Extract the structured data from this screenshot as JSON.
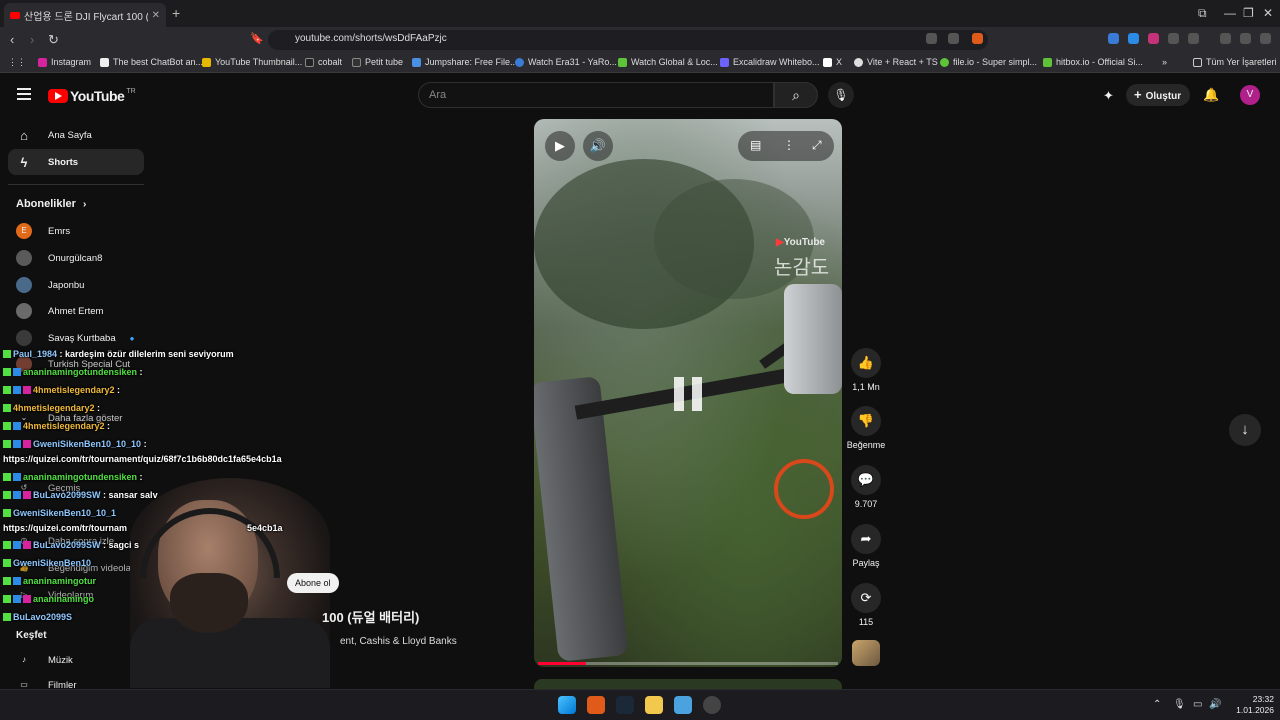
{
  "browser": {
    "tab_title": "산업용 드론 DJI Flycart 100 (듀얼 배터리)",
    "url": "youtube.com/shorts/wsDdFAaPzjc",
    "bookmarks": [
      "Instagram",
      "The best ChatBot an...",
      "YouTube Thumbnail...",
      "cobalt",
      "Petit tube",
      "Jumpshare: Free File...",
      "Watch Era31 - YaRo...",
      "Watch Global & Loc...",
      "Excalidraw Whitebo...",
      "X",
      "Vite + React + TS",
      "file.io - Super simpl...",
      "hitbox.io - Official Si..."
    ],
    "all_bookmarks_label": "Tüm Yer İşaretleri"
  },
  "header": {
    "logo_text": "YouTube",
    "logo_region": "TR",
    "search_placeholder": "Ara",
    "create_label": "Oluştur",
    "avatar_letter": "V"
  },
  "sidebar": {
    "home": "Ana Sayfa",
    "shorts": "Shorts",
    "subscriptions_heading": "Abonelikler",
    "subscriptions": [
      {
        "name": "Emrs",
        "initial": "E",
        "color": "#e06a1a"
      },
      {
        "name": "Onurgülcan8",
        "initial": "",
        "color": "#5a5a5a"
      },
      {
        "name": "Japonbu",
        "initial": "",
        "color": "#4a6a8a"
      },
      {
        "name": "Ahmet Ertem",
        "initial": "",
        "color": "#6a6a6a"
      },
      {
        "name": "Savaş Kurtbaba",
        "initial": "",
        "color": "#3a3a3a"
      },
      {
        "name": "Turkish Special Cut",
        "initial": "",
        "color": "#8a4a3a"
      }
    ],
    "show_more": "Daha fazla göster",
    "history": "Geçmiş",
    "watch_later": "Daha sonra izle",
    "liked": "Beğendiğim videolar",
    "your_videos": "Videolarım",
    "explore_heading": "Keşfet",
    "music": "Müzik",
    "films": "Filmler"
  },
  "chat": [
    {
      "user": "Paul_1984",
      "msg": " : kardeşim özür dilelerim seni seviyorum",
      "color": "user"
    },
    {
      "user": "ananinamingotundensiken",
      "msg": " : ",
      "color": "green"
    },
    {
      "user": "4hmetislegendary2",
      "msg": " : ",
      "color": "gold"
    },
    {
      "user": "4hmetislegendary2",
      "msg": " : ",
      "color": "gold"
    },
    {
      "user": "4hmetislegendary2",
      "msg": " : ",
      "color": "gold"
    },
    {
      "user": "GweniSikenBen10_10_10",
      "msg": " :",
      "color": "user"
    },
    {
      "user": "",
      "msg": "https://quizei.com/tr/tournament/quiz/68f7c1b6b80dc1fa65e4cb1a",
      "color": "msg"
    },
    {
      "user": "ananinamingotundensiken",
      "msg": " : ",
      "color": "green"
    },
    {
      "user": "BuLavo2099SW",
      "msg": " : sansar salv",
      "color": "user"
    },
    {
      "user": "GweniSikenBen10_10_1",
      "msg": "",
      "color": "user"
    },
    {
      "user": "",
      "msg": "https://quizei.com/tr/tournam",
      "color": "msg"
    },
    {
      "user": "BuLavo2099SW",
      "msg": " : sagci s",
      "color": "user"
    },
    {
      "user": "GweniSikenBen10_",
      "msg": "",
      "color": "user"
    },
    {
      "user": "ananinamingotur",
      "msg": "",
      "color": "green"
    },
    {
      "user": "ananinamingo",
      "msg": "",
      "color": "green"
    },
    {
      "user": "BuLavo2099S",
      "msg": "",
      "color": "user"
    }
  ],
  "chat_link_tail": "5e4cb1a",
  "video": {
    "title": "100 (듀얼 배터리)",
    "music": "ent, Cashis & Lloyd Banks",
    "subscribe_label": "Abone ol",
    "watermark_brand": "YouTube",
    "watermark_text": "논감도",
    "progress": 0.16
  },
  "actions": {
    "likes": "1,1 Mn",
    "dislike_label": "Beğenme",
    "comments": "9.707",
    "share_label": "Paylaş",
    "remix_count": "115"
  },
  "taskbar": {
    "time": "23:32",
    "date": "1.01.2026"
  }
}
